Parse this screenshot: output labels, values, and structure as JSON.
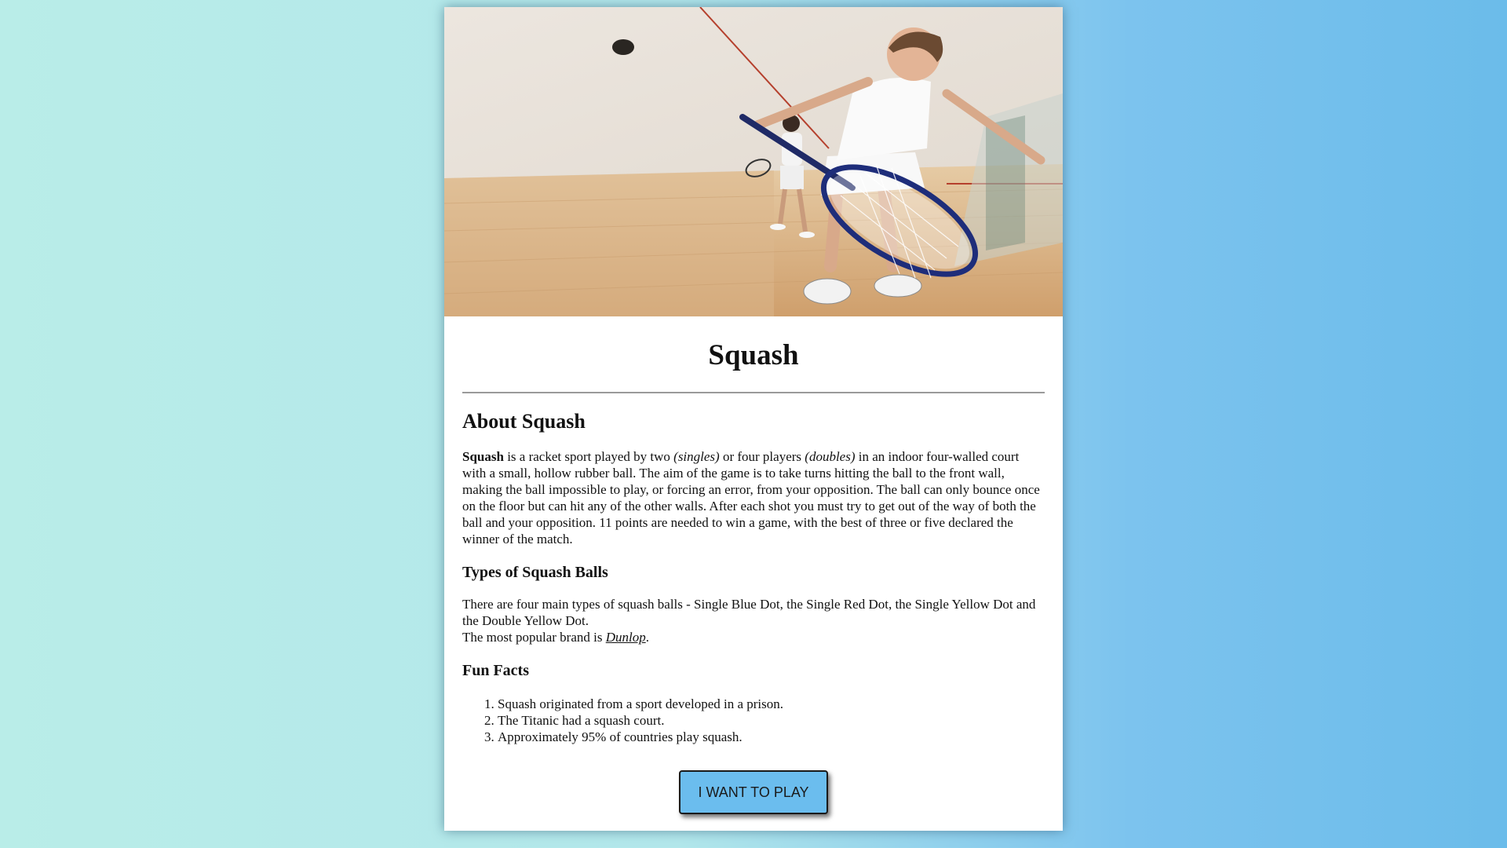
{
  "hero": {
    "image": "squash-player-photo"
  },
  "title": "Squash",
  "about": {
    "heading": "About Squash",
    "lead_bold": "Squash",
    "text_1": " is a racket sport played by two ",
    "italic_1": "(singles)",
    "text_2": " or four players ",
    "italic_2": "(doubles)",
    "text_3": " in an indoor four-walled court with a small, hollow rubber ball. The aim of the game is to take turns hitting the ball to the front wall, making the ball impossible to play, or forcing an error, from your opposition. The ball can only bounce once on the floor but can hit any of the other walls. After each shot you must try to get out of the way of both the ball and your opposition. 11 points are needed to win a game, with the best of three or five declared the winner of the match."
  },
  "balls": {
    "heading": "Types of Squash Balls",
    "text": "There are four main types of squash balls - Single Blue Dot, the Single Red Dot, the Single Yellow Dot and the Double Yellow Dot.",
    "brand_prefix": "The most popular brand is ",
    "brand_link": "Dunlop",
    "brand_suffix": "."
  },
  "facts": {
    "heading": "Fun Facts",
    "items": [
      "Squash originated from a sport developed in a prison.",
      "The Titanic had a squash court.",
      "Approximately 95% of countries play squash."
    ]
  },
  "cta": {
    "label": "I WANT TO PLAY"
  },
  "colors": {
    "button": "#6bbdee",
    "background_left": "#b9ede8",
    "background_right": "#6bbcea"
  }
}
